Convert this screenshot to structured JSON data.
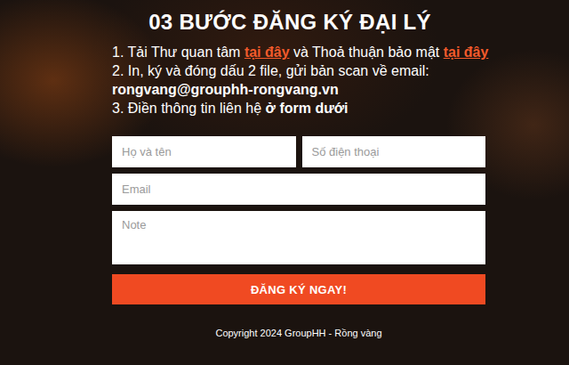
{
  "title": "03 BƯỚC ĐĂNG KÝ ĐẠI LÝ",
  "steps": [
    {
      "parts": [
        {
          "text": "1. Tải Thư quan tâm ",
          "kind": "plain"
        },
        {
          "text": "tại đây",
          "kind": "link"
        },
        {
          "text": " và Thoả thuận bảo mật ",
          "kind": "plain"
        },
        {
          "text": "tại đây",
          "kind": "link"
        }
      ]
    },
    {
      "parts": [
        {
          "text": "2. In, ký và đóng dấu 2 file, gửi bản scan về email:",
          "kind": "plain"
        },
        {
          "text": "rongvang@grouphh-rongvang.vn",
          "kind": "email"
        }
      ]
    },
    {
      "parts": [
        {
          "text": "3. Điền thông tin liên hệ ",
          "kind": "plain"
        },
        {
          "text": "ở form dưới",
          "kind": "bold"
        }
      ]
    }
  ],
  "form": {
    "name_placeholder": "Họ và tên",
    "phone_placeholder": "Số điện thoại",
    "email_placeholder": "Email",
    "note_placeholder": "Note"
  },
  "button": "ĐĂNG KÝ NGAY!",
  "footer": "Copyright 2024 GroupHH - Rồng vàng"
}
